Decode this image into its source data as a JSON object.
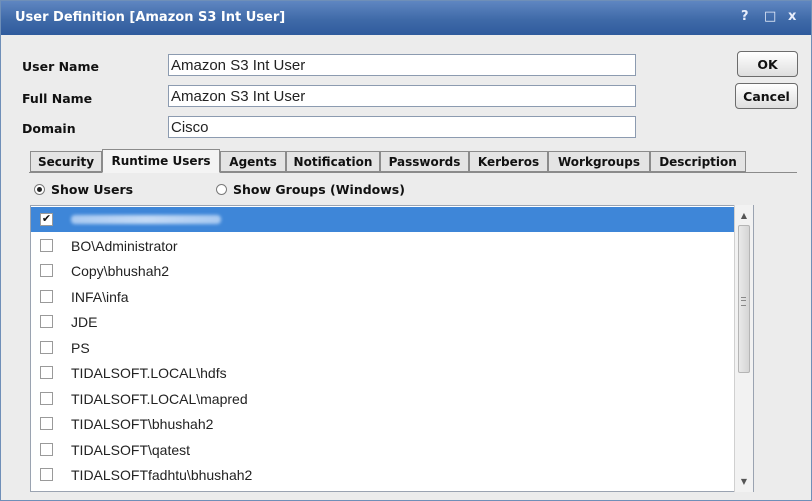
{
  "window": {
    "title": "User Definition [Amazon S3 Int User]",
    "help_glyph": "?",
    "restore_glyph": "□",
    "close_glyph": "x"
  },
  "form": {
    "user_name_label": "User Name",
    "user_name_value": "Amazon S3 Int User",
    "full_name_label": "Full Name",
    "full_name_value": "Amazon S3 Int User",
    "domain_label": "Domain",
    "domain_value": "Cisco"
  },
  "buttons": {
    "ok": "OK",
    "cancel": "Cancel"
  },
  "tabs": [
    {
      "label": "Security",
      "active": false
    },
    {
      "label": "Runtime Users",
      "active": true
    },
    {
      "label": "Agents",
      "active": false
    },
    {
      "label": "Notification",
      "active": false
    },
    {
      "label": "Passwords",
      "active": false
    },
    {
      "label": "Kerberos",
      "active": false
    },
    {
      "label": "Workgroups",
      "active": false
    },
    {
      "label": "Description",
      "active": false
    }
  ],
  "radios": {
    "show_users": "Show Users",
    "show_users_selected": true,
    "show_groups": "Show Groups (Windows)",
    "show_groups_selected": false
  },
  "users": [
    {
      "name": "",
      "checked": true,
      "selected": true,
      "obscured": true
    },
    {
      "name": "BO\\Administrator",
      "checked": false
    },
    {
      "name": "Copy\\bhushah2",
      "checked": false
    },
    {
      "name": "INFA\\infa",
      "checked": false
    },
    {
      "name": "JDE",
      "checked": false
    },
    {
      "name": "PS",
      "checked": false
    },
    {
      "name": "TIDALSOFT.LOCAL\\hdfs",
      "checked": false
    },
    {
      "name": "TIDALSOFT.LOCAL\\mapred",
      "checked": false
    },
    {
      "name": "TIDALSOFT\\bhushah2",
      "checked": false
    },
    {
      "name": "TIDALSOFT\\qatest",
      "checked": false
    },
    {
      "name": "TIDALSOFTfadhtu\\bhushah2",
      "checked": false
    }
  ],
  "colors": {
    "titlebar": "#3f6aa8",
    "selection": "#3e86d8"
  },
  "icons": {
    "check": "✔",
    "scroll_up": "▲",
    "scroll_down": "▼"
  }
}
